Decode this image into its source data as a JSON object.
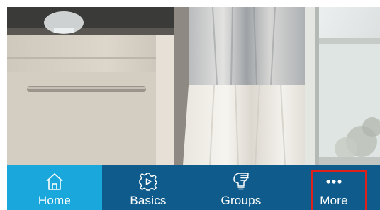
{
  "tabbar": {
    "tabs": [
      {
        "id": "home",
        "label": "Home",
        "icon": "home-icon",
        "selected": true
      },
      {
        "id": "basics",
        "label": "Basics",
        "icon": "gear-play-icon",
        "selected": false
      },
      {
        "id": "groups",
        "label": "Groups",
        "icon": "bulb-list-icon",
        "selected": false
      },
      {
        "id": "more",
        "label": "More",
        "icon": "more-dots-icon",
        "selected": false
      }
    ],
    "colors": {
      "bar": "#0f5c8c",
      "selected": "#1aa8dc",
      "highlight": "#e0201b"
    }
  }
}
